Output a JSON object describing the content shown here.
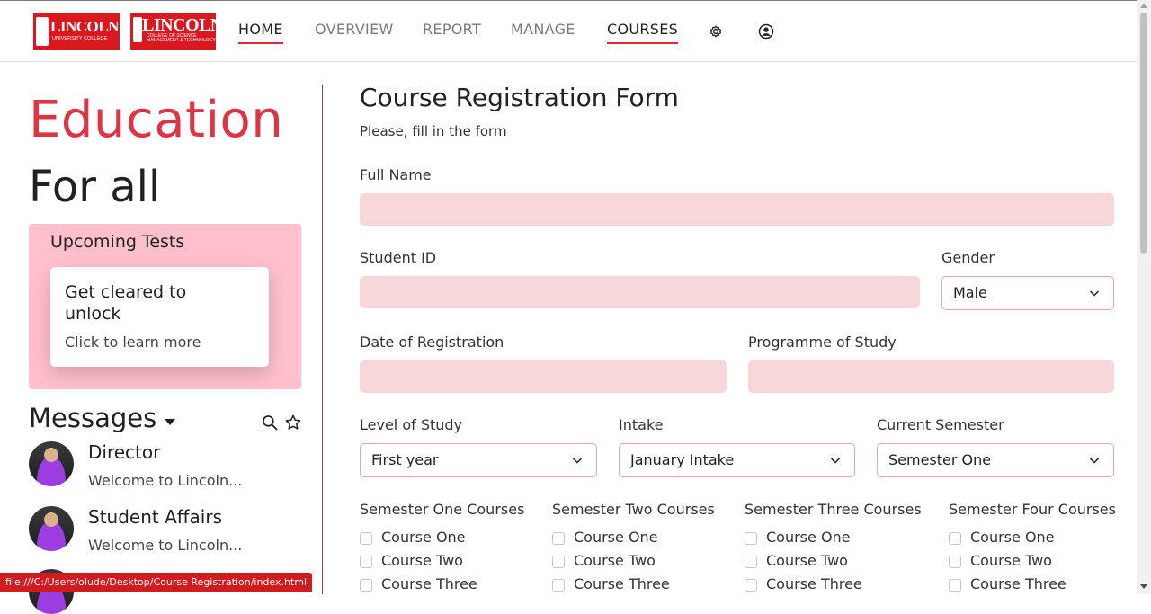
{
  "header": {
    "logo1": {
      "main": "LINCOLN",
      "sub": "UNIVERSITY COLLEGE"
    },
    "logo2": {
      "main": "LINCOLN",
      "sub": "COLLEGE OF SCIENCE MANAGEMENT & TECHNOLOGY"
    },
    "nav": [
      {
        "label": "HOME",
        "active": true
      },
      {
        "label": "OVERVIEW",
        "active": false
      },
      {
        "label": "REPORT",
        "active": false
      },
      {
        "label": "MANAGE",
        "active": false
      },
      {
        "label": "COURSES",
        "active": true
      }
    ],
    "icons": [
      "gear-icon",
      "user-icon"
    ]
  },
  "sidebar": {
    "hero_line1": "Education",
    "hero_line2": "For all",
    "tests": {
      "title": "Upcoming Tests",
      "card_title": "Get cleared to unlock",
      "card_sub": "Click to learn more"
    },
    "messages": {
      "title": "Messages",
      "items": [
        {
          "name": "Director",
          "preview": "Welcome to Lincoln..."
        },
        {
          "name": "Student Affairs",
          "preview": "Welcome to Lincoln..."
        }
      ]
    }
  },
  "form": {
    "title": "Course Registration Form",
    "subtitle": "Please, fill in the form",
    "full_name_label": "Full Name",
    "student_id_label": "Student ID",
    "gender_label": "Gender",
    "gender_value": "Male",
    "date_label": "Date of Registration",
    "programme_label": "Programme of Study",
    "level_label": "Level of Study",
    "level_value": "First year",
    "intake_label": "Intake",
    "intake_value": "January Intake",
    "semester_label": "Current Semester",
    "semester_value": "Semester One",
    "course_columns": [
      {
        "heading": "Semester One Courses",
        "courses": [
          "Course One",
          "Course Two",
          "Course Three"
        ]
      },
      {
        "heading": "Semester Two Courses",
        "courses": [
          "Course One",
          "Course Two",
          "Course Three"
        ]
      },
      {
        "heading": "Semester Three Courses",
        "courses": [
          "Course One",
          "Course Two",
          "Course Three"
        ]
      },
      {
        "heading": "Semester Four Courses",
        "courses": [
          "Course One",
          "Course Two",
          "Course Three"
        ]
      }
    ]
  },
  "status_bar": "file:///C:/Users/olude/Desktop/Course Registration/index.html",
  "colors": {
    "accent": "#dc3545",
    "input_bg": "#f8d7da",
    "tests_bg": "#ffc0cb"
  }
}
